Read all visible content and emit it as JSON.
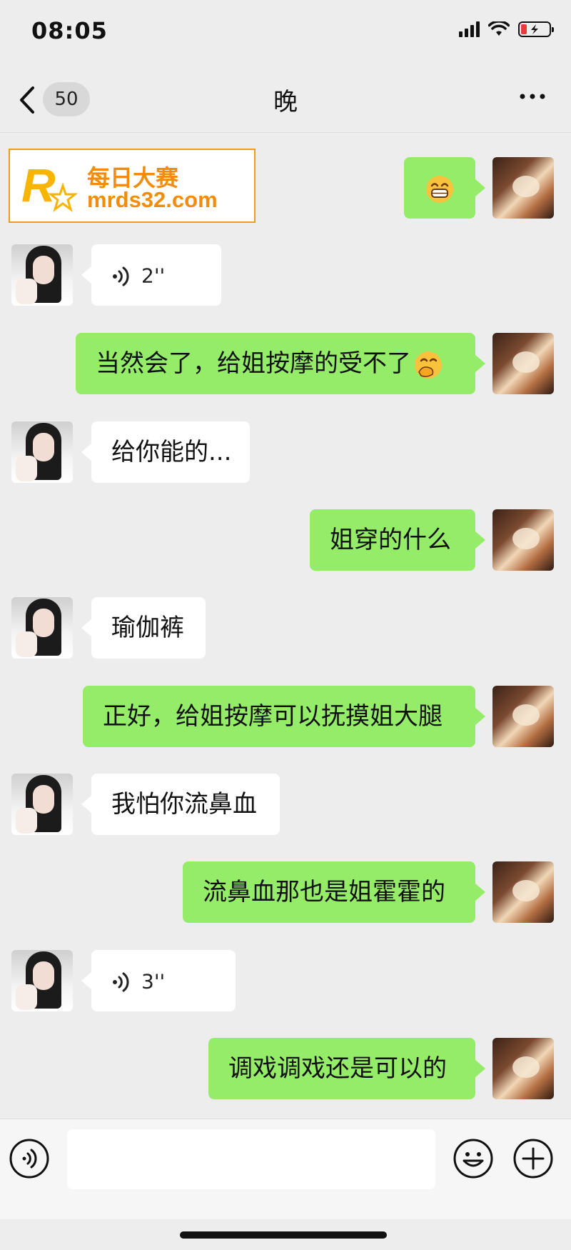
{
  "status_bar": {
    "time": "08:05"
  },
  "header": {
    "back_count": "50",
    "title": "晚"
  },
  "ad_banner": {
    "title": "每日大赛",
    "url": "mrds32.com",
    "logo_letter": "R",
    "brand_color": "#f28c0f"
  },
  "colors": {
    "self_bubble": "#95ec69",
    "other_bubble": "#ffffff",
    "background": "#ededed"
  },
  "messages": [
    {
      "sender": "self",
      "type": "emoji",
      "icon": "grinning-emoji"
    },
    {
      "sender": "other",
      "type": "voice",
      "duration": "2''"
    },
    {
      "sender": "self",
      "type": "text",
      "text": "当然会了，给姐按摩的受不了",
      "trailing_icon": "hand-over-mouth-emoji"
    },
    {
      "sender": "other",
      "type": "text",
      "text": "给你能的..."
    },
    {
      "sender": "self",
      "type": "text",
      "text": "姐穿的什么"
    },
    {
      "sender": "other",
      "type": "text",
      "text": "瑜伽裤"
    },
    {
      "sender": "self",
      "type": "text",
      "text": "正好，给姐按摩可以抚摸姐大腿"
    },
    {
      "sender": "other",
      "type": "text",
      "text": "我怕你流鼻血"
    },
    {
      "sender": "self",
      "type": "text",
      "text": "流鼻血那也是姐霍霍的"
    },
    {
      "sender": "other",
      "type": "voice",
      "duration": "3''"
    },
    {
      "sender": "self",
      "type": "text",
      "text": "调戏调戏还是可以的"
    }
  ],
  "input_bar": {
    "placeholder": "",
    "value": ""
  }
}
